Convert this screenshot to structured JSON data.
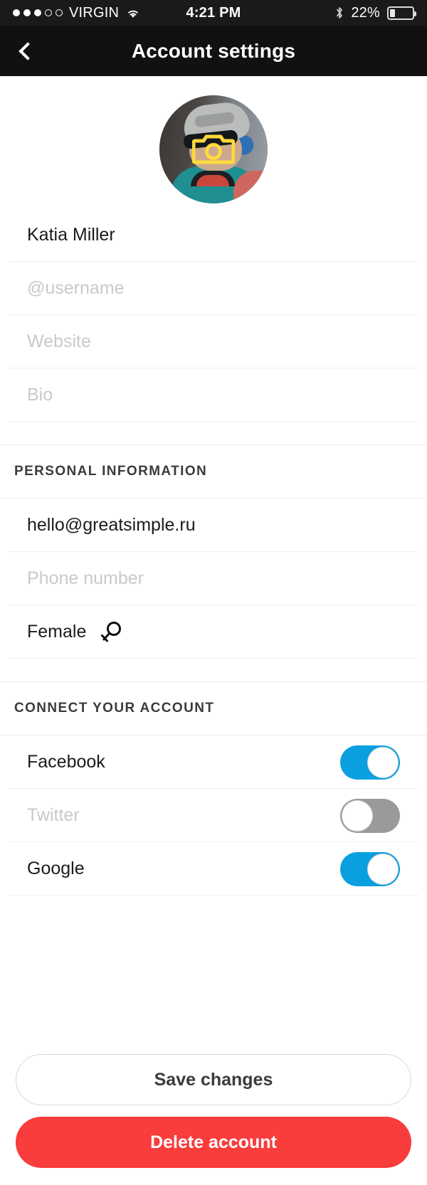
{
  "status_bar": {
    "carrier": "VIRGIN",
    "signal_dots_filled": 3,
    "signal_dots_total": 5,
    "wifi_icon": "wifi-icon",
    "time": "4:21 PM",
    "bluetooth_icon": "bluetooth-icon",
    "battery_percent": "22%",
    "battery_level": 22
  },
  "nav": {
    "back_icon": "chevron-left-icon",
    "title": "Account settings"
  },
  "avatar": {
    "name": "profile-photo",
    "overlay_icon": "camera-icon",
    "overlay_color": "#FFD93B"
  },
  "profile": {
    "fields": [
      {
        "name": "full-name",
        "value": "Katia Miller",
        "placeholder": "Full name",
        "is_placeholder": false
      },
      {
        "name": "username",
        "value": "@username",
        "placeholder": "@username",
        "is_placeholder": true
      },
      {
        "name": "website",
        "value": "Website",
        "placeholder": "Website",
        "is_placeholder": true
      },
      {
        "name": "bio",
        "value": "Bio",
        "placeholder": "Bio",
        "is_placeholder": true
      }
    ]
  },
  "personal": {
    "header": "PERSONAL INFORMATION",
    "email": {
      "value": "hello@greatsimple.ru",
      "placeholder": "Email",
      "is_placeholder": false
    },
    "phone": {
      "value": "Phone number",
      "placeholder": "Phone number",
      "is_placeholder": true
    },
    "gender": {
      "value": "Female",
      "icon": "venus-gender-icon"
    }
  },
  "connect": {
    "header": "CONNECT YOUR ACCOUNT",
    "accounts": [
      {
        "label": "Facebook",
        "enabled": true
      },
      {
        "label": "Twitter",
        "enabled": false
      },
      {
        "label": "Google",
        "enabled": true
      }
    ],
    "on_color": "#0AA0E0",
    "off_color": "#9A9A9A"
  },
  "actions": {
    "save_label": "Save changes",
    "delete_label": "Delete account",
    "delete_color": "#F93C3C"
  }
}
